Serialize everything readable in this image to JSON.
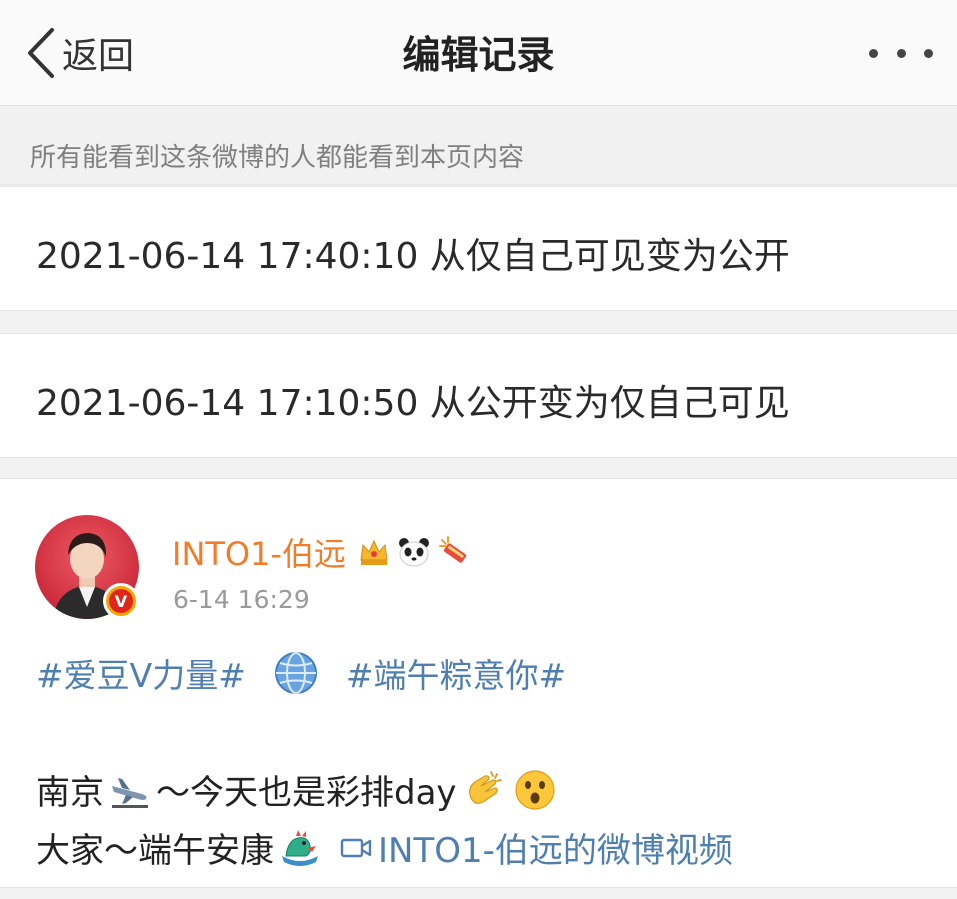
{
  "header": {
    "back_label": "返回",
    "title": "编辑记录",
    "more_icon": "more-dots-icon"
  },
  "notice": {
    "text": "所有能看到这条微博的人都能看到本页内容"
  },
  "history": [
    {
      "text": "2021-06-14 17:40:10 从仅自己可见变为公开"
    },
    {
      "text": "2021-06-14 17:10:50 从公开变为仅自己可见"
    }
  ],
  "post": {
    "username": "INTO1-伯远",
    "time": "6-14 16:29",
    "verified_icon": "verified-v-icon",
    "badges": [
      "crown-icon",
      "panda-icon",
      "firecracker-icon"
    ],
    "topics": [
      "#爱豆V力量#",
      "#端午粽意你#"
    ],
    "globe_icon": "globe-icon",
    "line1_text_a": "南京",
    "line1_text_b": "～今天也是彩排day",
    "line1_emojis": [
      "airplane-landing-emoji",
      "clapping-hands-emoji",
      "astonished-face-emoji"
    ],
    "line2_text": "大家～端午安康",
    "line2_emoji": "dragon-boat-emoji",
    "video_link": "INTO1-伯远的微博视频"
  },
  "colors": {
    "accent_link": "#4f7fb0",
    "username": "#f17c2a",
    "muted": "#9a9a9a"
  }
}
